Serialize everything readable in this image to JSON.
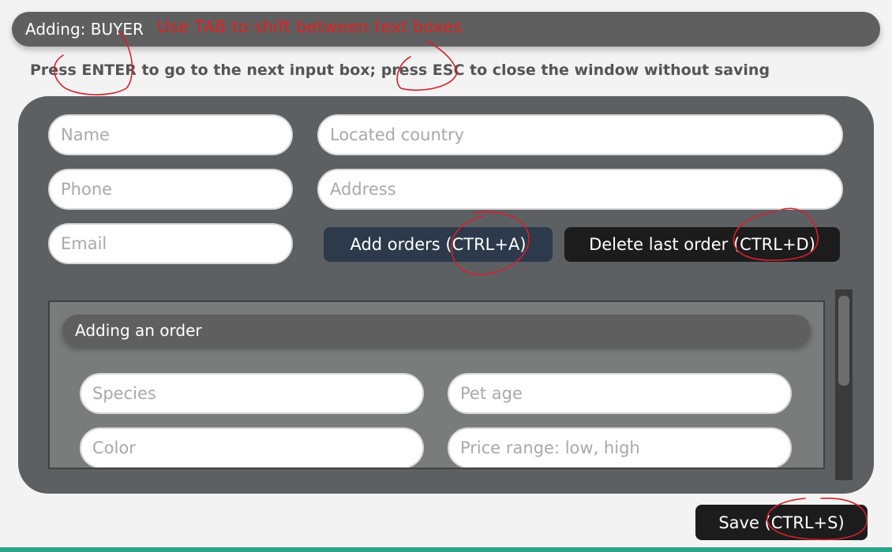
{
  "window": {
    "title": "Adding: BUYER",
    "tab_hint": "Use TAB to shift between text boxes",
    "instructions": "Press ENTER to go to the next input box; press ESC to close the window without saving"
  },
  "buyer_form": {
    "name_placeholder": "Name",
    "phone_placeholder": "Phone",
    "email_placeholder": "Email",
    "country_placeholder": "Located country",
    "address_placeholder": "Address",
    "add_orders_label": "Add orders (CTRL+A)",
    "delete_order_label": "Delete last order (CTRL+D)"
  },
  "order": {
    "header": "Adding an order",
    "species_placeholder": "Species",
    "pet_age_placeholder": "Pet age",
    "color_placeholder": "Color",
    "price_range_placeholder": "Price range: low, high"
  },
  "footer": {
    "save_label": "Save (CTRL+S)"
  },
  "colors": {
    "panel": "#5c6063",
    "titlebar": "#5f5f5f",
    "add_button": "#2c3a4b",
    "dark_button": "#1c1c1c",
    "annotation": "#e02020"
  }
}
